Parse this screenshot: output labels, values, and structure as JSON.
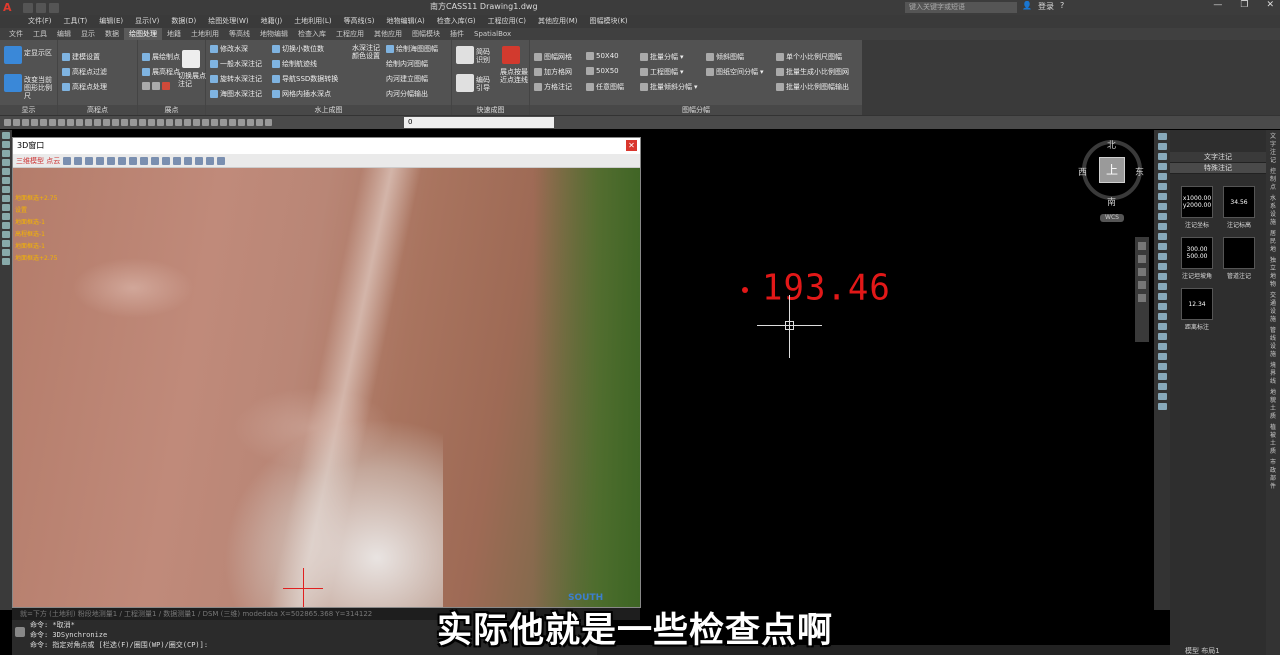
{
  "titlebar": {
    "title": "南方CASS11    Drawing1.dwg",
    "search_placeholder": "键入关键字或短语",
    "user": "登录",
    "controls": [
      "—",
      "❐",
      "✕"
    ]
  },
  "menubar": [
    "文件(F)",
    "工具(T)",
    "编辑(E)",
    "显示(V)",
    "数据(D)",
    "绘图处理(W)",
    "地籍(J)",
    "土地利用(L)",
    "等高线(S)",
    "地物编辑(A)",
    "检查入库(G)",
    "工程应用(C)",
    "其他应用(M)",
    "图幅模块(K)"
  ],
  "tabs": [
    "文件",
    "工具",
    "编辑",
    "显示",
    "数据",
    "绘图处理",
    "地籍",
    "土地利用",
    "等高线",
    "地物编辑",
    "检查入库",
    "工程应用",
    "其他应用",
    "图幅模块",
    "插件",
    "SpatialBox"
  ],
  "active_tab": "绘图处理",
  "ribbon": {
    "groups": [
      {
        "title": "显示",
        "items": [
          "定显示区",
          "改变当前图形比例尺"
        ]
      },
      {
        "title": "高程点",
        "items": [
          "建模设置",
          "高程点过滤",
          "高程点处理"
        ]
      },
      {
        "title": "展点",
        "items": [
          "展绘制点",
          "展高程点",
          "切换展点注记"
        ]
      },
      {
        "title": "水上成图",
        "items": [
          "修改水深",
          "一般水深注记",
          "旋转水深注记",
          "海图水深注记",
          "切换小数位数",
          "绘制航迹线",
          "导航SSD数据转换",
          "网格内插水深点",
          "水深注记颜色设置",
          "绘制海图图幅",
          "绘制内河图幅",
          "内河建立图幅",
          "内河分幅输出"
        ]
      },
      {
        "title": "快速成图",
        "items": [
          "简码识别",
          "编码引导",
          "展点按最近点连线"
        ]
      },
      {
        "title": "图幅分幅",
        "items": [
          "图幅网格",
          "加方格网",
          "方格注记",
          "50X40",
          "50X50",
          "任意图幅",
          "批量分幅",
          "工程图幅",
          "批量倾斜分幅",
          "倾斜图幅",
          "图纸空间分幅",
          "单个小比例尺图幅",
          "批量生成小比例图网",
          "批量小比例图幅输出"
        ]
      }
    ]
  },
  "layer_combo": "0",
  "drawing": {
    "elevation_label": "193.46"
  },
  "viewcube": {
    "face": "上",
    "north": "北",
    "south": "南",
    "east": "东",
    "west": "西",
    "wcs": "WCS"
  },
  "palette": {
    "tabs": [
      "文字注记",
      "特殊注记"
    ],
    "items": [
      {
        "preview": "x1000.00 y2000.00",
        "label": "注记坐标"
      },
      {
        "preview": "34.56",
        "label": "注记标高"
      },
      {
        "preview": "300.00 500.00",
        "label": "注记坦坡角"
      },
      {
        "preview": "",
        "label": "管道注记"
      },
      {
        "preview": "12.34",
        "label": "距离标注"
      }
    ],
    "side_tabs": [
      "文字注记",
      "控制点",
      "水系设施",
      "居民地",
      "独立地物",
      "交通设施",
      "管线设施",
      "境界线",
      "地貌土质",
      "植被土质",
      "市政部件"
    ]
  },
  "window3d": {
    "title": "3D窗口",
    "mode": "三维模型 点云",
    "overlay_lines": [
      "地面框选+2.75",
      "设置",
      "地面框选-1",
      "高程框选-1",
      "地面框选-1",
      "地面框选+2.75"
    ],
    "watermark": "SOUTH"
  },
  "statusline": "就=下方 (土地利)  粉段地测量1 / 工程测量1 / 数据测量1 / DSM (三维)   modedata X=502865.368  Y=314122",
  "command_lines": [
    "命令: *取消*",
    "命令: 3DSynchronize",
    "命令: 指定对角点或 [栏选(F)/圈围(WP)/圈交(CP)]:"
  ],
  "bottom_right": "模型  布局1",
  "subtitle": "实际他就是一些检查点啊"
}
